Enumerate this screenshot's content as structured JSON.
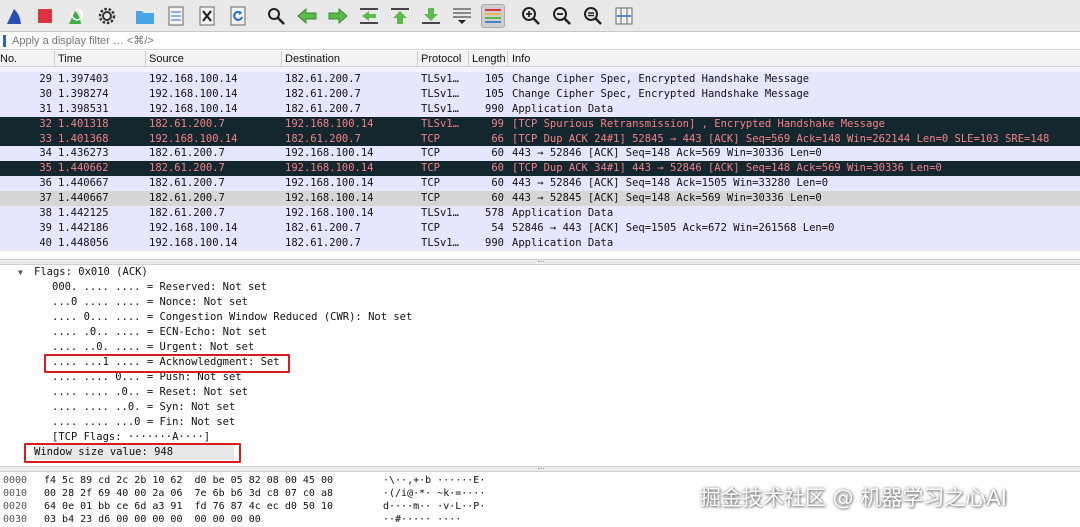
{
  "toolbar": {
    "buttons": [
      {
        "name": "shark-fin-start-icon"
      },
      {
        "name": "stop-capture-icon"
      },
      {
        "name": "restart-capture-icon"
      },
      {
        "name": "capture-options-gear-icon"
      },
      {
        "name": "open-folder-icon"
      },
      {
        "name": "save-file-icon"
      },
      {
        "name": "close-file-icon"
      },
      {
        "name": "reload-icon"
      },
      {
        "name": "find-packet-icon"
      },
      {
        "name": "go-back-icon"
      },
      {
        "name": "go-forward-icon"
      },
      {
        "name": "go-to-packet-icon"
      },
      {
        "name": "go-first-packet-icon"
      },
      {
        "name": "go-last-packet-icon"
      },
      {
        "name": "auto-scroll-icon"
      },
      {
        "name": "colorize-icon"
      },
      {
        "name": "zoom-in-icon"
      },
      {
        "name": "zoom-out-icon"
      },
      {
        "name": "normal-size-icon"
      },
      {
        "name": "resize-columns-icon"
      }
    ]
  },
  "filter": {
    "placeholder": "Apply a display filter … <⌘/>"
  },
  "packet_list": {
    "headers": {
      "no": "No.",
      "time": "Time",
      "source": "Source",
      "destination": "Destination",
      "protocol": "Protocol",
      "length": "Length",
      "info": "Info"
    },
    "rows": [
      {
        "no": "29",
        "time": "1.397403",
        "src": "192.168.100.14",
        "dst": "182.61.200.7",
        "proto": "TLSv1…",
        "len": "105",
        "info": "Change Cipher Spec, Encrypted Handshake Message",
        "style": "tls"
      },
      {
        "no": "30",
        "time": "1.398274",
        "src": "192.168.100.14",
        "dst": "182.61.200.7",
        "proto": "TLSv1…",
        "len": "105",
        "info": "Change Cipher Spec, Encrypted Handshake Message",
        "style": "tls"
      },
      {
        "no": "31",
        "time": "1.398531",
        "src": "192.168.100.14",
        "dst": "182.61.200.7",
        "proto": "TLSv1…",
        "len": "990",
        "info": "Application Data",
        "style": "tls"
      },
      {
        "no": "32",
        "time": "1.401318",
        "src": "182.61.200.7",
        "dst": "192.168.100.14",
        "proto": "TLSv1…",
        "len": "99",
        "info": "[TCP Spurious Retransmission] , Encrypted Handshake Message",
        "style": "bad"
      },
      {
        "no": "33",
        "time": "1.401368",
        "src": "192.168.100.14",
        "dst": "182.61.200.7",
        "proto": "TCP",
        "len": "66",
        "info": "[TCP Dup ACK 24#1] 52845 → 443 [ACK] Seq=569 Ack=148 Win=262144 Len=0 SLE=103 SRE=148",
        "style": "bad"
      },
      {
        "no": "34",
        "time": "1.436273",
        "src": "182.61.200.7",
        "dst": "192.168.100.14",
        "proto": "TCP",
        "len": "60",
        "info": "443 → 52846 [ACK] Seq=148 Ack=569 Win=30336 Len=0",
        "style": "tcp"
      },
      {
        "no": "35",
        "time": "1.440662",
        "src": "182.61.200.7",
        "dst": "192.168.100.14",
        "proto": "TCP",
        "len": "60",
        "info": "[TCP Dup ACK 34#1] 443 → 52846 [ACK] Seq=148 Ack=569 Win=30336 Len=0",
        "style": "bad"
      },
      {
        "no": "36",
        "time": "1.440667",
        "src": "182.61.200.7",
        "dst": "192.168.100.14",
        "proto": "TCP",
        "len": "60",
        "info": "443 → 52846 [ACK] Seq=148 Ack=1505 Win=33280 Len=0",
        "style": "tcp"
      },
      {
        "no": "37",
        "time": "1.440667",
        "src": "182.61.200.7",
        "dst": "192.168.100.14",
        "proto": "TCP",
        "len": "60",
        "info": "443 → 52845 [ACK] Seq=148 Ack=569 Win=30336 Len=0",
        "style": "sel"
      },
      {
        "no": "38",
        "time": "1.442125",
        "src": "182.61.200.7",
        "dst": "192.168.100.14",
        "proto": "TLSv1…",
        "len": "578",
        "info": "Application Data",
        "style": "tls"
      },
      {
        "no": "39",
        "time": "1.442186",
        "src": "192.168.100.14",
        "dst": "182.61.200.7",
        "proto": "TCP",
        "len": "54",
        "info": "52846 → 443 [ACK] Seq=1505 Ack=672 Win=261568 Len=0",
        "style": "tcp"
      },
      {
        "no": "40",
        "time": "1.448056",
        "src": "192.168.100.14",
        "dst": "182.61.200.7",
        "proto": "TLSv1…",
        "len": "990",
        "info": "Application Data",
        "style": "tls"
      }
    ]
  },
  "details": {
    "flags_header": "Flags: 0x010 (ACK)",
    "flags": [
      "000. .... .... = Reserved: Not set",
      "...0 .... .... = Nonce: Not set",
      ".... 0... .... = Congestion Window Reduced (CWR): Not set",
      ".... .0.. .... = ECN-Echo: Not set",
      ".... ..0. .... = Urgent: Not set",
      ".... ...1 .... = Acknowledgment: Set",
      ".... .... 0... = Push: Not set",
      ".... .... .0.. = Reset: Not set",
      ".... .... ..0. = Syn: Not set",
      ".... .... ...0 = Fin: Not set"
    ],
    "tcp_flags_line": "[TCP Flags: ·······A····]",
    "window_size": "Window size value: 948"
  },
  "bytes": [
    {
      "offset": "0000",
      "hex": "f4 5c 89 cd 2c 2b 10 62  d0 be 05 82 08 00 45 00",
      "ascii": "·\\··,+·b ······E·"
    },
    {
      "offset": "0010",
      "hex": "00 28 2f 69 40 00 2a 06  7e 6b b6 3d c8 07 c0 a8",
      "ascii": "·(/i@·*· ~k·=····"
    },
    {
      "offset": "0020",
      "hex": "64 0e 01 bb ce 6d a3 91  fd 76 87 4c ec d0 50 10",
      "ascii": "d····m·· ·v·L··P·"
    },
    {
      "offset": "0030",
      "hex": "03 b4 23 d6 00 00 00 00  00 00 00 00",
      "ascii": "··#····· ····"
    }
  ],
  "watermark": "掘金技术社区 @ 机器学习之心AI",
  "colors": {
    "tls_row": "#e7e6ff",
    "bad_row_bg": "#12272e",
    "bad_row_fg": "#f78087",
    "selected_row": "#d6d6d6",
    "highlight_box": "#dc1c1c"
  }
}
